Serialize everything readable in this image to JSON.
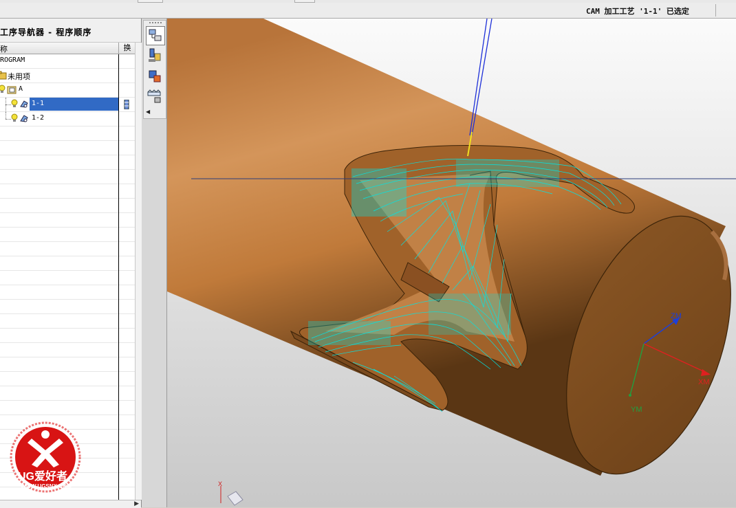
{
  "status": {
    "text": "CAM 加工工艺 '1-1' 已选定"
  },
  "navigator": {
    "title": "工序导航器 - 程序顺序",
    "columns": {
      "name": "名称",
      "toolchange": "换"
    },
    "items": [
      {
        "label": "NC_PROGRAM",
        "visible_label": "ROGRAM",
        "icon": "program-root-icon"
      },
      {
        "label": "未用项",
        "icon": "folder-icon"
      },
      {
        "label": "A",
        "icon": "program-folder-icon"
      },
      {
        "label": "1-1",
        "icon": "operation-icon",
        "selected": true
      },
      {
        "label": "1-2",
        "icon": "operation-icon",
        "selected": false
      }
    ]
  },
  "resource_bar": {
    "buttons": [
      "operation-navigator-icon",
      "machine-tool-navigator-icon",
      "part-navigator-icon",
      "reuse-library-icon"
    ]
  },
  "viewport": {
    "axes": {
      "z": "ZM",
      "x": "XM",
      "y": "YM"
    },
    "small_axis": "X",
    "colors": {
      "background_top": "#f4f4f4",
      "background_bottom": "#c9c9c9",
      "part": "#c07a3a",
      "toolpath": "#00e5e5",
      "tool_axis": "#1d2fd8"
    }
  },
  "watermark": {
    "brand": "UG爱好者",
    "url": "WWW.UGSNX.COM"
  }
}
